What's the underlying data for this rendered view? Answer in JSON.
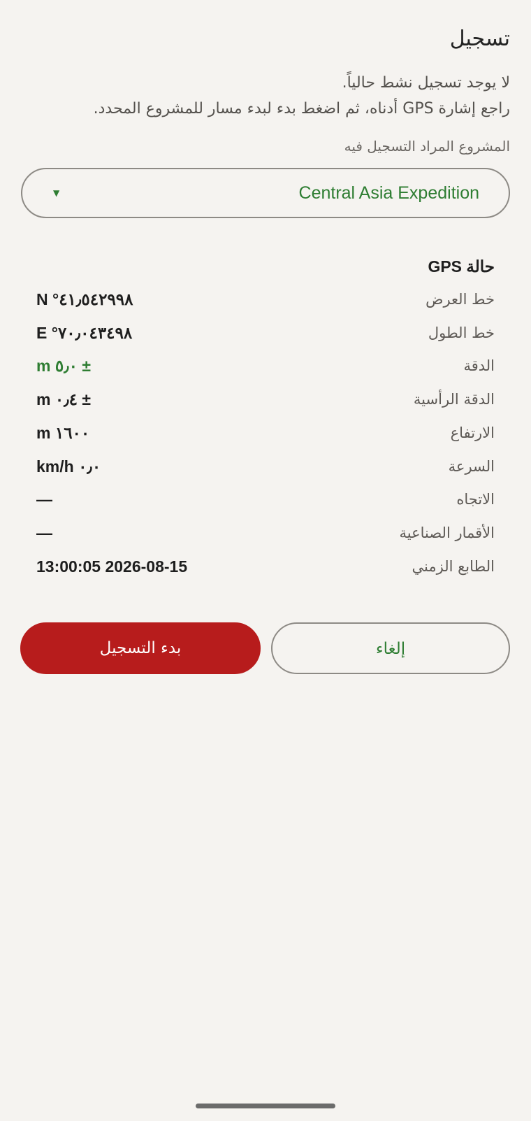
{
  "screen": {
    "title": "تسجيل",
    "intro_line1": "لا يوجد تسجيل نشط حالياً.",
    "intro_line2": "راجع إشارة GPS أدناه، ثم اضغط بدء لبدء مسار للمشروع المحدد."
  },
  "project": {
    "label": "المشروع المراد التسجيل فيه",
    "selected": "Central Asia Expedition",
    "caret": "▼"
  },
  "gps": {
    "header": "حالة GPS",
    "rows": [
      {
        "label": "خط العرض",
        "value": "N °٤١٫٥٤٢٩٩٨"
      },
      {
        "label": "خط الطول",
        "value": "E °٧٠٫٠٤٣٤٩٨"
      },
      {
        "label": "الدقة",
        "value": "m ٥٫٠ ±"
      },
      {
        "label": "الدقة الرأسية",
        "value": "m ٠٫٤ ±"
      },
      {
        "label": "الارتفاع",
        "value": "m ١٦٠٠"
      },
      {
        "label": "السرعة",
        "value": "km/h ٠٫٠"
      },
      {
        "label": "الاتجاه",
        "value": "—"
      },
      {
        "label": "الأقمار الصناعية",
        "value": "—"
      },
      {
        "label": "الطابع الزمني",
        "value": "13:00:05 2026-08-15"
      }
    ]
  },
  "actions": {
    "start_label": "بدء التسجيل",
    "cancel_label": "إلغاء"
  },
  "colors": {
    "accent_green": "#2e7d32",
    "primary_red": "#b71c1c",
    "background": "#f5f3f0"
  }
}
